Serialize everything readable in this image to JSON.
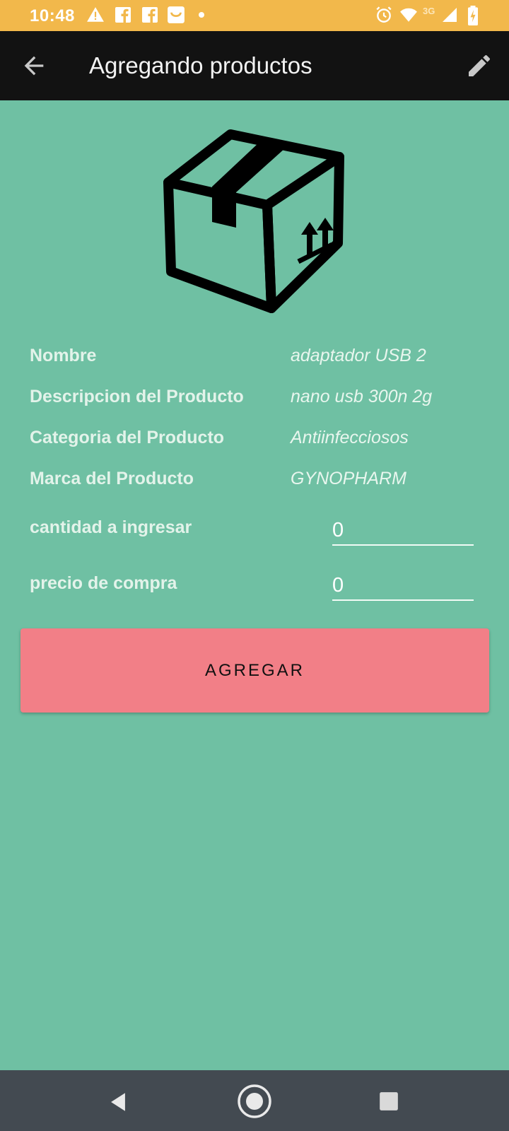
{
  "status_bar": {
    "time": "10:48",
    "network": "3G",
    "icons": [
      "warning-icon",
      "facebook-icon",
      "facebook-icon",
      "inbox-icon",
      "dot-icon",
      "alarm-icon",
      "wifi-icon",
      "signal-icon",
      "battery-charging-icon"
    ]
  },
  "app_bar": {
    "title": "Agregando productos",
    "back_icon": "arrow-left-icon",
    "edit_icon": "pencil-icon"
  },
  "product": {
    "image_icon": "cardboard-box-icon",
    "rows": [
      {
        "label": "Nombre",
        "value": "adaptador USB 2"
      },
      {
        "label": "Descripcion del Producto",
        "value": "nano usb 300n 2g"
      },
      {
        "label": "Categoria del Producto",
        "value": "Antiinfecciosos"
      },
      {
        "label": "Marca del Producto",
        "value": "GYNOPHARM"
      }
    ]
  },
  "form": {
    "quantity_label": "cantidad a ingresar",
    "quantity_value": "0",
    "price_label": "precio de compra",
    "price_value": "0",
    "submit_label": "AGREGAR"
  },
  "colors": {
    "status_bar": "#f2b84b",
    "app_bar": "#121212",
    "background": "#6fc0a3",
    "button": "#f27f87",
    "nav_bar": "#434a51"
  },
  "nav_bar": {
    "buttons": [
      "back-triangle-icon",
      "home-circle-icon",
      "recents-square-icon"
    ]
  }
}
